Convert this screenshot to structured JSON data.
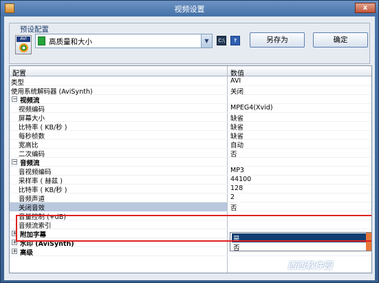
{
  "window": {
    "title": "视频设置",
    "close_label": "x"
  },
  "preset": {
    "group_label": "预设配置",
    "icon_tag": "AVI",
    "selected": "高质量和大小",
    "small_btn1": "C:\\",
    "small_btn2": "?",
    "save_as": "另存为",
    "ok": "确定"
  },
  "grid": {
    "col_config": "配置",
    "col_value": "数值",
    "rows": [
      {
        "label": "类型",
        "value": "AVI",
        "indent": 0,
        "type": "item"
      },
      {
        "label": "使用系统解码器 (AviSynth)",
        "value": "关闭",
        "indent": 0,
        "type": "item"
      },
      {
        "label": "视频流",
        "value": "",
        "indent": 0,
        "type": "section",
        "toggle": "−"
      },
      {
        "label": "视频编码",
        "value": "MPEG4(Xvid)",
        "indent": 1,
        "type": "item"
      },
      {
        "label": "屏幕大小",
        "value": "缺省",
        "indent": 1,
        "type": "item"
      },
      {
        "label": "比特率 ( KB/秒 )",
        "value": "缺省",
        "indent": 1,
        "type": "item"
      },
      {
        "label": "每秒桢数",
        "value": "缺省",
        "indent": 1,
        "type": "item"
      },
      {
        "label": "宽高比",
        "value": "自动",
        "indent": 1,
        "type": "item"
      },
      {
        "label": "二次编码",
        "value": "否",
        "indent": 1,
        "type": "item"
      },
      {
        "label": "音频流",
        "value": "",
        "indent": 0,
        "type": "section",
        "toggle": "−"
      },
      {
        "label": "音视频编码",
        "value": "MP3",
        "indent": 1,
        "type": "item"
      },
      {
        "label": "采样率 ( 赫兹 )",
        "value": "44100",
        "indent": 1,
        "type": "item"
      },
      {
        "label": "比特率 ( KB/秒 )",
        "value": "128",
        "indent": 1,
        "type": "item"
      },
      {
        "label": "音频声道",
        "value": "2",
        "indent": 1,
        "type": "item"
      },
      {
        "label": "关闭音效",
        "value": "否",
        "indent": 1,
        "type": "item",
        "selected": true
      },
      {
        "label": "音量控制 (+dB)",
        "value": "",
        "indent": 1,
        "type": "item"
      },
      {
        "label": "音频流索引",
        "value": "",
        "indent": 1,
        "type": "item"
      },
      {
        "label": "附加字幕",
        "value": "",
        "indent": 0,
        "type": "section",
        "toggle": "+"
      },
      {
        "label": "水印 (AviSynth)",
        "value": "",
        "indent": 0,
        "type": "section",
        "toggle": "+"
      },
      {
        "label": "高级",
        "value": "",
        "indent": 0,
        "type": "section",
        "toggle": "+"
      }
    ],
    "dropdown_options": [
      "是",
      "否"
    ]
  },
  "watermark": "西西软件园"
}
